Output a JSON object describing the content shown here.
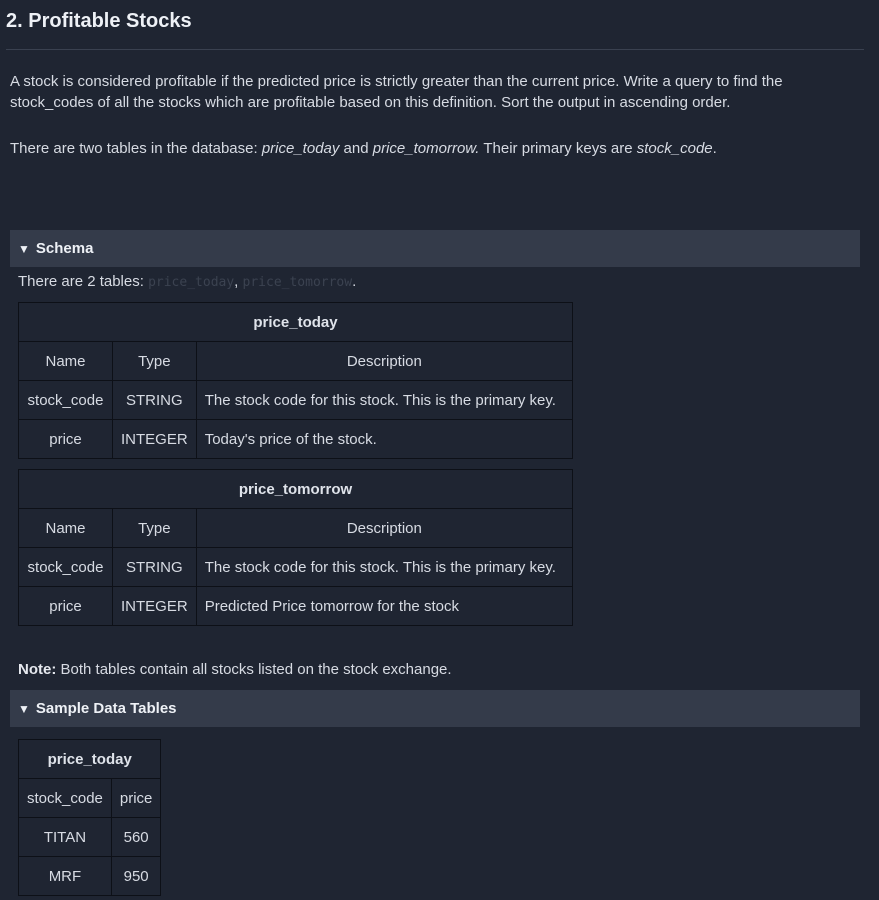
{
  "title": "2. Profitable Stocks",
  "description": {
    "p1": "A stock is considered profitable if the predicted price is strictly greater than the current price. Write a query to find the stock_codes of all the stocks which are profitable based on this definition. Sort the output in ascending order.",
    "p2_prefix": "There are two tables in the database: ",
    "p2_table1": "price_today",
    "p2_and": " and ",
    "p2_table2": "price_tomorrow.",
    "p2_mid": " Their primary keys are ",
    "p2_key": "stock_code",
    "p2_end": "."
  },
  "schema": {
    "section_label": "Schema",
    "intro_prefix": "There are 2 tables: ",
    "intro_t1": "price_today",
    "intro_sep": ", ",
    "intro_t2": "price_tomorrow",
    "intro_end": ".",
    "columns": [
      "Name",
      "Type",
      "Description"
    ],
    "tables": [
      {
        "name": "price_today",
        "rows": [
          [
            "stock_code",
            "STRING",
            "The stock code for this stock. This is the primary key."
          ],
          [
            "price",
            "INTEGER",
            "Today's price of the stock."
          ]
        ]
      },
      {
        "name": "price_tomorrow",
        "rows": [
          [
            "stock_code",
            "STRING",
            "The stock code for this stock. This is the primary key."
          ],
          [
            "price",
            "INTEGER",
            "Predicted Price tomorrow for the stock"
          ]
        ]
      }
    ],
    "note_label": "Note:",
    "note_text": " Both tables contain all stocks listed on the stock exchange."
  },
  "sample": {
    "section_label": "Sample Data Tables",
    "table_name": "price_today",
    "columns": [
      "stock_code",
      "price"
    ],
    "rows": [
      [
        "TITAN",
        "560"
      ],
      [
        "MRF",
        "950"
      ]
    ]
  }
}
